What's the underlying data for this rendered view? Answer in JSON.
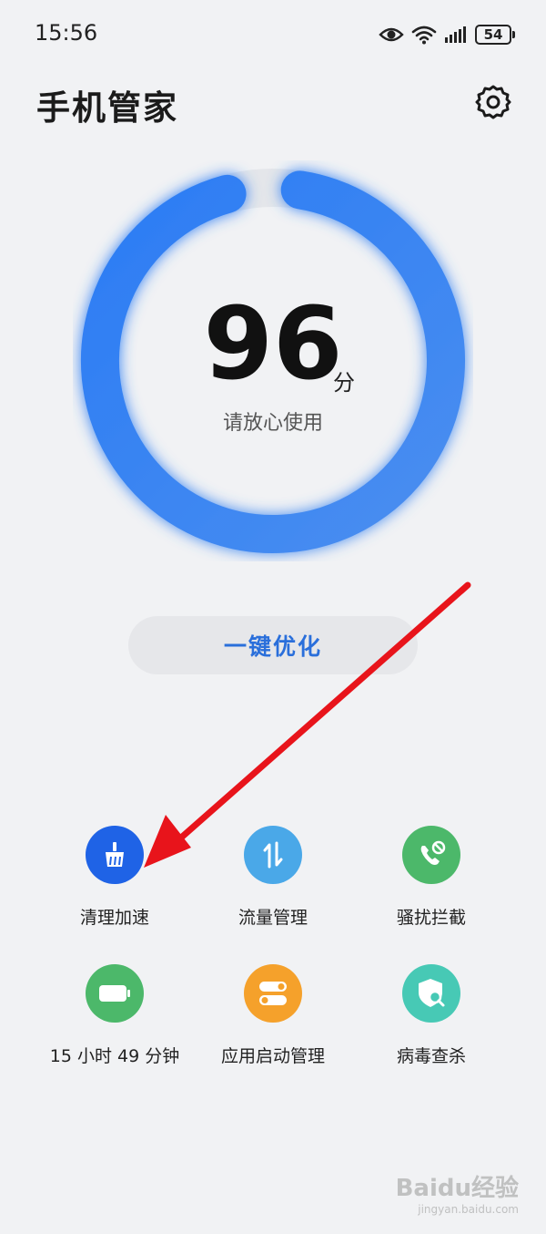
{
  "status_bar": {
    "time": "15:56",
    "battery": "54",
    "icons": [
      "eye-icon",
      "wifi-icon",
      "signal-icon",
      "battery-icon"
    ]
  },
  "header": {
    "title": "手机管家",
    "settings_icon": "gear-icon"
  },
  "score": {
    "value": "96",
    "unit": "分",
    "caption": "请放心使用",
    "level": 0.96,
    "ring_color": "#2f80f5"
  },
  "optimize_button": {
    "label": "一键优化"
  },
  "tools": [
    {
      "label": "清理加速",
      "icon": "broom-icon",
      "color": "#1f63e6"
    },
    {
      "label": "流量管理",
      "icon": "data-transfer-icon",
      "color": "#4aa8e8"
    },
    {
      "label": "骚扰拦截",
      "icon": "phone-block-icon",
      "color": "#4cb86a"
    },
    {
      "label": "15 小时 49 分钟",
      "icon": "battery-icon",
      "color": "#4cb86a"
    },
    {
      "label": "应用启动管理",
      "icon": "toggle-icon",
      "color": "#f5a12b"
    },
    {
      "label": "病毒查杀",
      "icon": "shield-scan-icon",
      "color": "#47c9b5"
    }
  ],
  "annotation": {
    "arrow_color": "#e8141b"
  },
  "watermark": {
    "brand": "Baidu经验",
    "url": "jingyan.baidu.com"
  }
}
